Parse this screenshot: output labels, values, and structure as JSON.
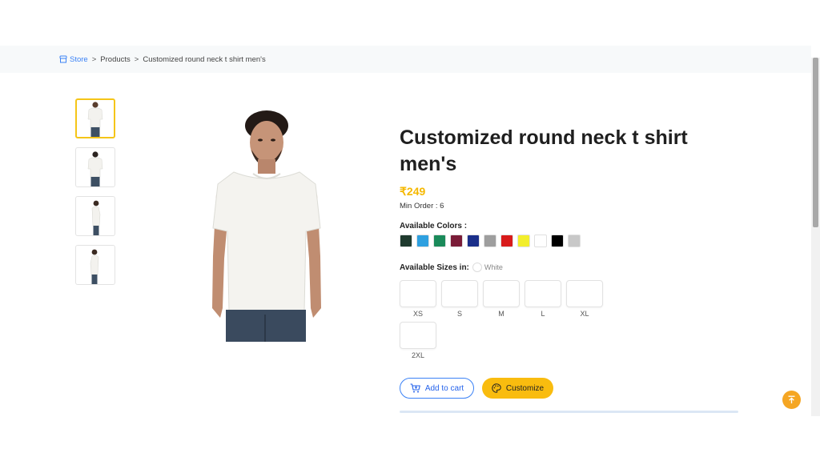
{
  "breadcrumb": {
    "items": [
      "Store",
      "Products",
      "Customized round neck t shirt men's"
    ],
    "separator": ">"
  },
  "product": {
    "title": "Customized round neck t shirt men's",
    "price": "₹249",
    "min_order": "Min Order : 6"
  },
  "colors": {
    "label": "Available Colors :",
    "swatches": [
      "#1f3a2e",
      "#2ea0e0",
      "#1a8a5a",
      "#7a1c38",
      "#1b2f8a",
      "#9e9e9e",
      "#d81b1b",
      "#f2ee2c",
      "#ffffff",
      "#000000",
      "#c8c8c8"
    ]
  },
  "sizes": {
    "label": "Available Sizes in:",
    "selected_color": "White",
    "options": [
      "XS",
      "S",
      "M",
      "L",
      "XL",
      "2XL"
    ]
  },
  "actions": {
    "add_to_cart": "Add to cart",
    "customize": "Customize"
  },
  "theme": {
    "accent": "#f9bc0f",
    "link": "#3b82f6",
    "price": "#f5b800"
  },
  "icons": {
    "store": "store-icon",
    "cart": "cart-icon",
    "palette": "palette-icon",
    "scroll_top": "arrow-up-icon"
  }
}
